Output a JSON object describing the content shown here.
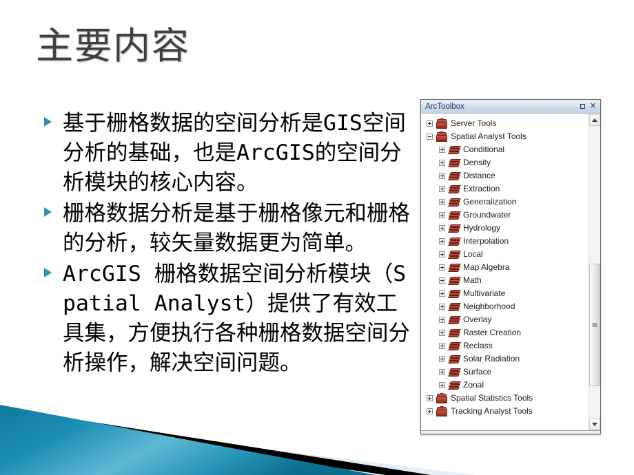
{
  "slide": {
    "title": "主要内容",
    "bullets": [
      "基于栅格数据的空间分析是GIS空间分析的基础，也是ArcGIS的空间分析模块的核心内容。",
      "栅格数据分析是基于栅格像元和栅格的分析，较矢量数据更为简单。",
      "ArcGIS 栅格数据空间分析模块（Spatial Analyst）提供了有效工具集，方便执行各种栅格数据空间分析操作，解决空间问题。"
    ]
  },
  "arctoolbox": {
    "window_title": "ArcToolbox",
    "maximize_label": "□",
    "close_label": "✕",
    "tree": [
      {
        "label": "Server Tools",
        "level": 1,
        "icon": "toolbox-icon",
        "state": "collapsed"
      },
      {
        "label": "Spatial Analyst Tools",
        "level": 1,
        "icon": "toolbox-icon",
        "state": "expanded"
      },
      {
        "label": "Conditional",
        "level": 2,
        "icon": "toolset-icon",
        "state": "collapsed"
      },
      {
        "label": "Density",
        "level": 2,
        "icon": "toolset-icon",
        "state": "collapsed"
      },
      {
        "label": "Distance",
        "level": 2,
        "icon": "toolset-icon",
        "state": "collapsed"
      },
      {
        "label": "Extraction",
        "level": 2,
        "icon": "toolset-icon",
        "state": "collapsed"
      },
      {
        "label": "Generalization",
        "level": 2,
        "icon": "toolset-icon",
        "state": "collapsed"
      },
      {
        "label": "Groundwater",
        "level": 2,
        "icon": "toolset-icon",
        "state": "collapsed"
      },
      {
        "label": "Hydrology",
        "level": 2,
        "icon": "toolset-icon",
        "state": "collapsed"
      },
      {
        "label": "Interpolation",
        "level": 2,
        "icon": "toolset-icon",
        "state": "collapsed"
      },
      {
        "label": "Local",
        "level": 2,
        "icon": "toolset-icon",
        "state": "collapsed"
      },
      {
        "label": "Map Algebra",
        "level": 2,
        "icon": "toolset-icon",
        "state": "collapsed"
      },
      {
        "label": "Math",
        "level": 2,
        "icon": "toolset-icon",
        "state": "collapsed"
      },
      {
        "label": "Multivariate",
        "level": 2,
        "icon": "toolset-icon",
        "state": "collapsed"
      },
      {
        "label": "Neighborhood",
        "level": 2,
        "icon": "toolset-icon",
        "state": "collapsed"
      },
      {
        "label": "Overlay",
        "level": 2,
        "icon": "toolset-icon",
        "state": "collapsed"
      },
      {
        "label": "Raster Creation",
        "level": 2,
        "icon": "toolset-icon",
        "state": "collapsed"
      },
      {
        "label": "Reclass",
        "level": 2,
        "icon": "toolset-icon",
        "state": "collapsed"
      },
      {
        "label": "Solar Radiation",
        "level": 2,
        "icon": "toolset-icon",
        "state": "collapsed"
      },
      {
        "label": "Surface",
        "level": 2,
        "icon": "toolset-icon",
        "state": "collapsed"
      },
      {
        "label": "Zonal",
        "level": 2,
        "icon": "toolset-icon",
        "state": "collapsed"
      },
      {
        "label": "Spatial Statistics Tools",
        "level": 1,
        "icon": "toolbox-icon",
        "state": "collapsed"
      },
      {
        "label": "Tracking Analyst Tools",
        "level": 1,
        "icon": "toolbox-icon",
        "state": "collapsed"
      }
    ]
  },
  "colors": {
    "bullet_marker": "#2d94b4",
    "title_text": "#3f3f3f",
    "toolbox_icon_red": "#a83327",
    "deco_teal": "#1c8aad",
    "deco_light_blue": "#dbe9f0",
    "deco_black": "#000000"
  }
}
